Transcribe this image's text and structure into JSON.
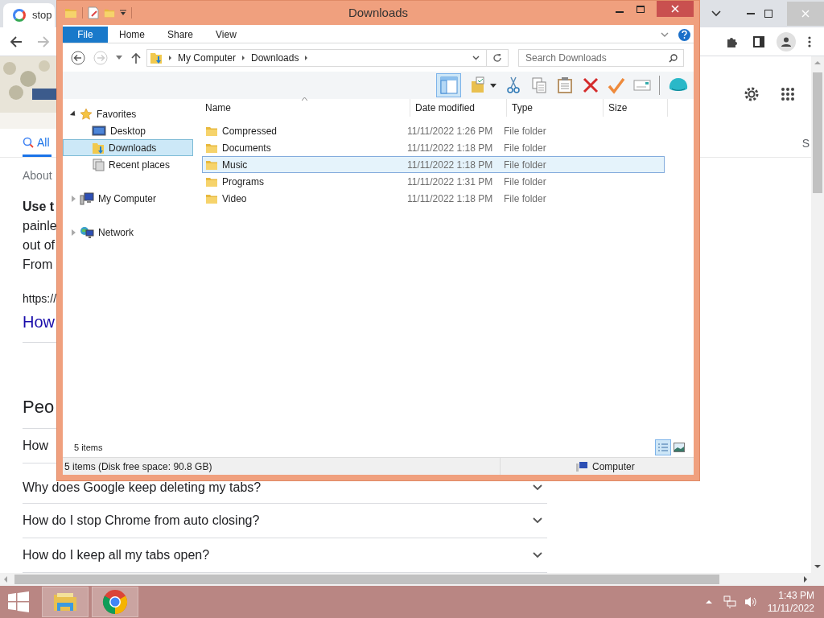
{
  "browser": {
    "tab_title": "stop",
    "search_tabs": [
      {
        "label": "All",
        "selected": true
      },
      {
        "label": "S",
        "selected": false
      }
    ],
    "result_stats": "About",
    "snippet": [
      {
        "text": "Use t",
        "bold": true
      },
      {
        "text": "painle",
        "bold": false
      },
      {
        "text": "out of",
        "bold": false
      },
      {
        "text": "From",
        "bold": false
      }
    ],
    "result_url": "https://",
    "result_title": "How",
    "people_also_ask": {
      "heading": "Peo",
      "questions": [
        {
          "text": "How"
        },
        {
          "text": "Why does Google keep deleting my tabs?"
        },
        {
          "text": "How do I stop Chrome from auto closing?"
        },
        {
          "text": "How do I keep all my tabs open?"
        }
      ]
    }
  },
  "explorer": {
    "title": "Downloads",
    "file_tab": "File",
    "ribbon_tabs": [
      {
        "label": "Home",
        "selected": false
      },
      {
        "label": "Share",
        "selected": false
      },
      {
        "label": "View",
        "selected": false
      }
    ],
    "address": [
      "My Computer",
      "Downloads"
    ],
    "search": {
      "placeholder": "Search Downloads"
    },
    "layout_pane_on": true,
    "nav": [
      {
        "label": "Favorites",
        "kind": "favorites",
        "expanded": true,
        "selected": false,
        "children": [
          {
            "label": "Desktop",
            "kind": "desktop",
            "selected": false
          },
          {
            "label": "Downloads",
            "kind": "downloads",
            "selected": true
          },
          {
            "label": "Recent places",
            "kind": "recent",
            "selected": false
          }
        ]
      },
      {
        "label": "My Computer",
        "kind": "computer",
        "expanded": false,
        "selected": false
      },
      {
        "label": "Network",
        "kind": "network",
        "expanded": false,
        "selected": false
      }
    ],
    "columns": [
      {
        "label": "Name",
        "sorted": true
      },
      {
        "label": "Date modified",
        "sorted": false
      },
      {
        "label": "Type",
        "sorted": false
      },
      {
        "label": "Size",
        "sorted": false
      }
    ],
    "rows": [
      {
        "name": "Compressed",
        "date": "11/11/2022 1:26 PM",
        "type": "File folder",
        "selected": false
      },
      {
        "name": "Documents",
        "date": "11/11/2022 1:18 PM",
        "type": "File folder",
        "selected": false
      },
      {
        "name": "Music",
        "date": "11/11/2022 1:18 PM",
        "type": "File folder",
        "selected": true
      },
      {
        "name": "Programs",
        "date": "11/11/2022 1:31 PM",
        "type": "File folder",
        "selected": false
      },
      {
        "name": "Video",
        "date": "11/11/2022 1:18 PM",
        "type": "File folder",
        "selected": false
      }
    ],
    "item_count": "5 items",
    "views": [
      {
        "kind": "details",
        "selected": true
      },
      {
        "kind": "large_icons",
        "selected": false
      }
    ],
    "status_text": "5 items (Disk free space: 90.8 GB)",
    "status_location": "Computer"
  },
  "taskbar": {
    "time": "1:43 PM",
    "date": "11/11/2022"
  }
}
